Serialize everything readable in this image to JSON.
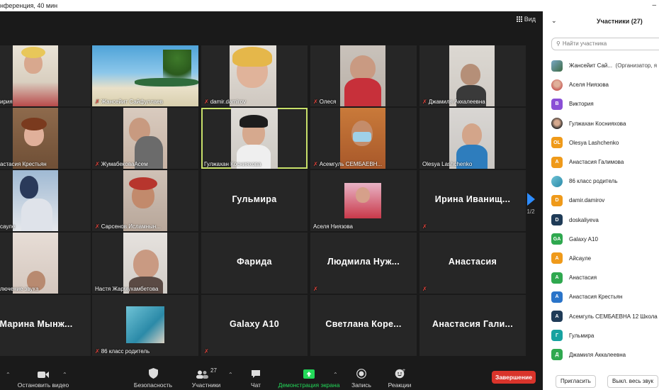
{
  "window": {
    "title": "нференция, 40 мин",
    "view_label": "Вид"
  },
  "tiles": [
    {
      "label": "ирия",
      "muted": false
    },
    {
      "label": "Жансейит Сайфуллаев",
      "muted": true
    },
    {
      "label": "damir.damirov",
      "muted": true
    },
    {
      "label": "Олеся",
      "muted": true
    },
    {
      "label": "Джамиля Аккалеевна",
      "muted": true
    },
    {
      "label": "астасия Крестьян",
      "muted": false
    },
    {
      "label": "ЖумабековаАсем",
      "muted": true
    },
    {
      "label": "Гулжахан Коснияхова",
      "muted": false,
      "active": true
    },
    {
      "label": "Асемгуль СЕМБАЕВН...",
      "muted": true
    },
    {
      "label": "Olesya Lashchenko",
      "muted": false
    },
    {
      "label": "сауле",
      "muted": false
    },
    {
      "label": "Сарсенов Исламнын...",
      "muted": true
    },
    {
      "big_name": "Гульмира",
      "muted": false
    },
    {
      "label": "Аселя Ниязова",
      "muted": false
    },
    {
      "big_name": "Ирина Иванищ...",
      "muted": true
    },
    {
      "label": "лючение звука",
      "muted": false
    },
    {
      "label": "Настя Жармухамбетова",
      "muted": false
    },
    {
      "big_name": "Фарида",
      "muted": false
    },
    {
      "big_name": "Людмила Нуж...",
      "muted": true
    },
    {
      "big_name": "Анастасия",
      "muted": true
    },
    {
      "big_name": "Марина Мынж...",
      "muted": false
    },
    {
      "label": "86 класс родитель",
      "muted": true
    },
    {
      "big_name": "Galaxy A10",
      "muted": true
    },
    {
      "big_name": "Светлана Коре...",
      "muted": false
    },
    {
      "big_name": "Анастасия Гали...",
      "muted": false
    }
  ],
  "pager": {
    "label": "1/2",
    "color": "#2d8cff"
  },
  "toolbar": {
    "stop_video": "Остановить видео",
    "security": "Безопасность",
    "participants": "Участники",
    "participants_count": "27",
    "chat": "Чат",
    "share_screen": "Демонстрация экрана",
    "record": "Запись",
    "reactions": "Реакции",
    "end": "Завершение",
    "share_color": "#23d959",
    "end_color": "#d9342b"
  },
  "panel": {
    "title": "Участники (27)",
    "search_placeholder": "Найти участника",
    "invite": "Пригласить",
    "mute_all": "Выкл. весь звук",
    "participants": [
      {
        "name": "Жансейит Сай...",
        "note": "(Организатор, я",
        "avatar": "",
        "color": "#7aa7c4",
        "photo": true
      },
      {
        "name": "Аселя Ниязова",
        "avatar": "",
        "color": "#c8605a",
        "photo": true
      },
      {
        "name": "Виктория",
        "avatar": "В",
        "color": "#8a4fd6",
        "photo": false
      },
      {
        "name": "Гулжахан Коснияхова",
        "avatar": "",
        "color": "#7a6a5a",
        "photo": true
      },
      {
        "name": "Olesya Lashchenko",
        "avatar": "OL",
        "color": "#ef9a1a",
        "photo": false
      },
      {
        "name": "Анастасия Галимова",
        "avatar": "А",
        "color": "#ef9a1a",
        "photo": false
      },
      {
        "name": "86 класс родитель",
        "avatar": "",
        "color": "#5fa0b5",
        "photo": true
      },
      {
        "name": "damir.damirov",
        "avatar": "D",
        "color": "#ef9a1a",
        "photo": false
      },
      {
        "name": "doskaliyeva",
        "avatar": "D",
        "color": "#1f3b57",
        "photo": false
      },
      {
        "name": "Galaxy A10",
        "avatar": "GA",
        "color": "#2fa84f",
        "photo": false
      },
      {
        "name": "Айсауле",
        "avatar": "А",
        "color": "#ef9a1a",
        "photo": false
      },
      {
        "name": "Анастасия",
        "avatar": "А",
        "color": "#2fa84f",
        "photo": false
      },
      {
        "name": "Анастасия Крестьян",
        "avatar": "А",
        "color": "#2a74c9",
        "photo": false
      },
      {
        "name": "Асемгуль СЕМБАЕВНА 12 Школа",
        "avatar": "А",
        "color": "#1f3b57",
        "photo": false
      },
      {
        "name": "Гульмира",
        "avatar": "Г",
        "color": "#17a2a0",
        "photo": false
      },
      {
        "name": "Джамиля Аккалеевна",
        "avatar": "Д",
        "color": "#2fa84f",
        "photo": false
      }
    ]
  }
}
